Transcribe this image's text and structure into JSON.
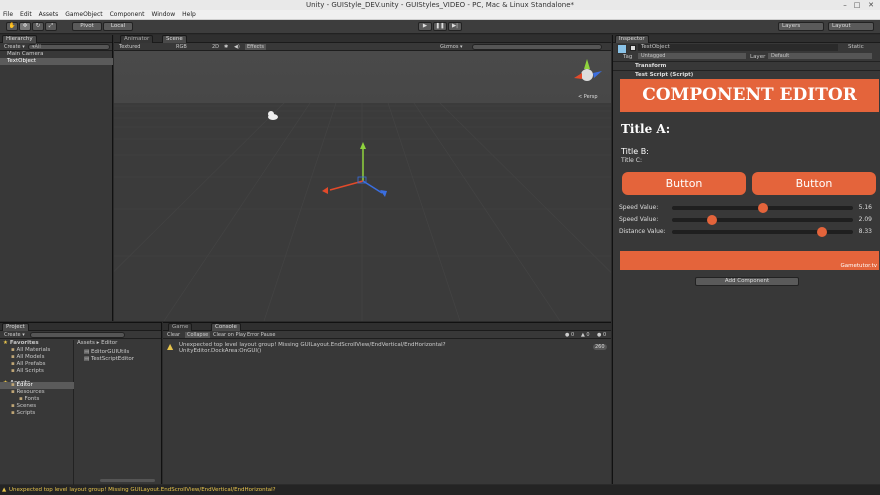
{
  "window": {
    "title": "Unity - GUIStyle_DEV.unity - GUIStyles_VIDEO - PC, Mac & Linux Standalone*",
    "minimize": "–",
    "maximize": "□",
    "close": "✕"
  },
  "menu": [
    "File",
    "Edit",
    "Assets",
    "GameObject",
    "Component",
    "Window",
    "Help"
  ],
  "toolbar": {
    "pivot": "Pivot",
    "local": "Local",
    "layers": "Layers",
    "layout": "Layout"
  },
  "hierarchy": {
    "tab": "Hierarchy",
    "create": "Create ▾",
    "search": "▾All",
    "items": [
      {
        "label": "Main Camera"
      },
      {
        "label": "TextObject"
      }
    ]
  },
  "scene": {
    "tab_animator": "Animator",
    "tab_scene": "Scene",
    "shading": "Textured",
    "rgb": "RGB",
    "mode2d": "2D",
    "effects": "Effects",
    "gizmos": "Gizmos ▾",
    "persp": "< Persp"
  },
  "project": {
    "tab": "Project",
    "create": "Create ▾",
    "breadcrumb": "Assets ▸ Editor",
    "tree": [
      {
        "label": "Favorites",
        "bold": true,
        "indent": 0
      },
      {
        "label": "All Materials",
        "indent": 1
      },
      {
        "label": "All Models",
        "indent": 1
      },
      {
        "label": "All Prefabs",
        "indent": 1
      },
      {
        "label": "All Scripts",
        "indent": 1
      },
      {
        "label": "Assets",
        "bold": true,
        "indent": 0
      },
      {
        "label": "Editor",
        "indent": 1,
        "selected": true
      },
      {
        "label": "Resources",
        "indent": 1
      },
      {
        "label": "Fonts",
        "indent": 2
      },
      {
        "label": "Scenes",
        "indent": 1
      },
      {
        "label": "Scripts",
        "indent": 1
      }
    ],
    "files": [
      "EditorGUIUtils",
      "TestScriptEditor"
    ]
  },
  "console": {
    "tab_game": "Game",
    "tab_console": "Console",
    "clear": "Clear",
    "collapse": "Collapse",
    "clear_on_play": "Clear on Play",
    "error_pause": "Error Pause",
    "message_line1": "Unexpected top level layout group! Missing GUILayout.EndScrollView/EndVertical/EndHorizontal?",
    "message_line2": "UnityEditor.DockArea:OnGUI()",
    "count": "260"
  },
  "inspector": {
    "tab": "Inspector",
    "object_name": "TestObject",
    "static": "Static",
    "tag_label": "Tag",
    "tag_value": "Untagged",
    "layer_label": "Layer",
    "layer_value": "Default",
    "transform": "Transform",
    "script": "Test Script (Script)",
    "add_component": "Add Component"
  },
  "component_editor": {
    "header": "COMPONENT EDITOR",
    "title_a": "Title A:",
    "title_b": "Title B:",
    "title_c": "Title C:",
    "button1": "Button",
    "button2": "Button",
    "sliders": [
      {
        "label": "Speed Value:",
        "value": "5.16",
        "fraction": 0.5
      },
      {
        "label": "Speed Value:",
        "value": "2.09",
        "fraction": 0.22
      },
      {
        "label": "Distance Value:",
        "value": "8.33",
        "fraction": 0.83
      }
    ],
    "footer": "Gametutor.tv"
  },
  "status": {
    "message": "Unexpected top level layout group! Missing GUILayout.EndScrollView/EndVertical/EndHorizontal?"
  },
  "colors": {
    "accent": "#e4643b",
    "panel": "#383838",
    "warning": "#e8c54c"
  }
}
